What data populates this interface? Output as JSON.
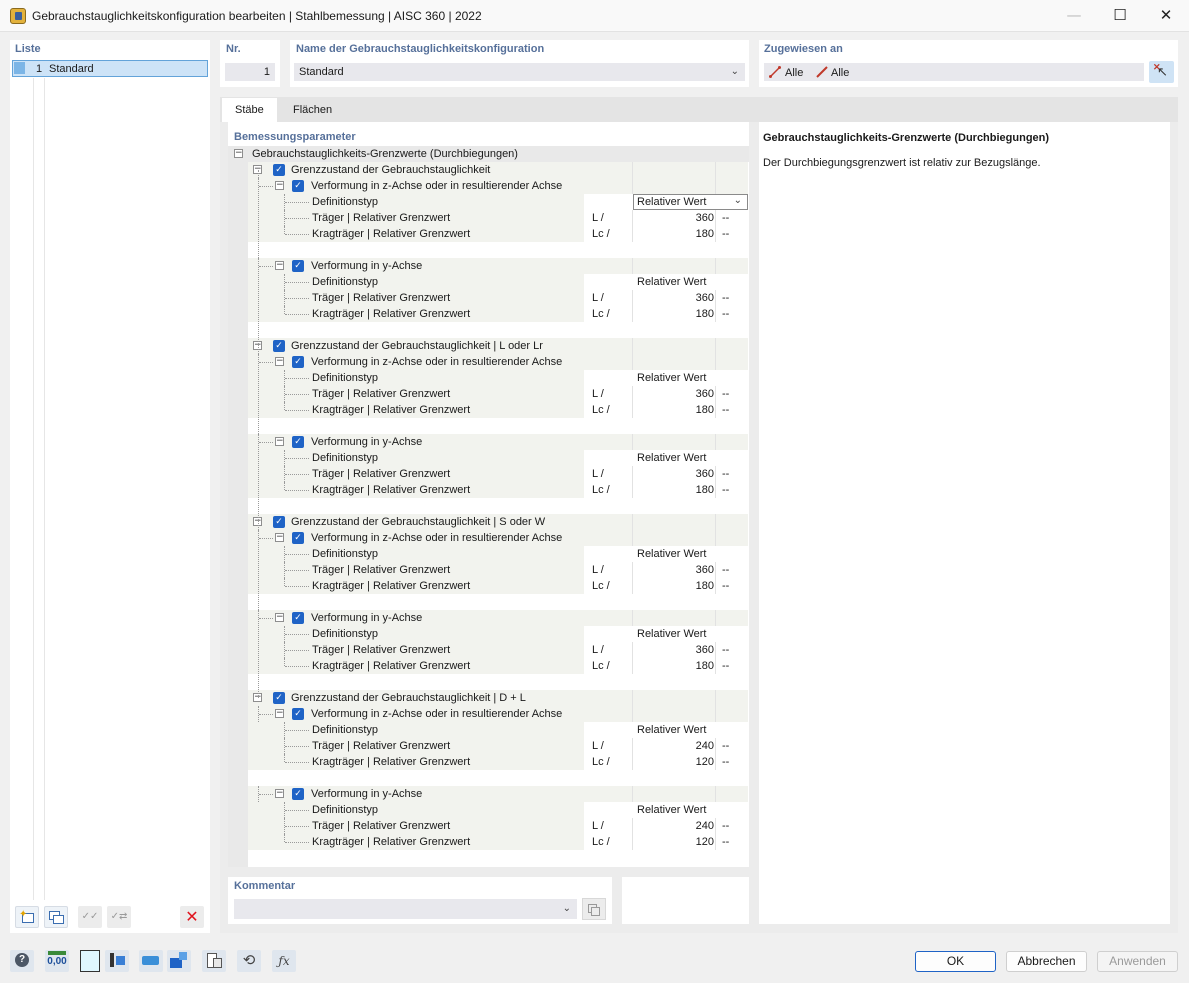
{
  "window": {
    "title": "Gebrauchstauglichkeitskonfiguration bearbeiten | Stahlbemessung | AISC 360 | 2022",
    "minimize": "—",
    "maximize": "☐",
    "close": "✕"
  },
  "list": {
    "label": "Liste",
    "items": [
      {
        "nr": "1",
        "name": "Standard"
      }
    ]
  },
  "nr": {
    "label": "Nr.",
    "value": "1"
  },
  "name": {
    "label": "Name der Gebrauchstauglichkeitskonfiguration",
    "value": "Standard"
  },
  "assigned": {
    "label": "Zugewiesen an",
    "members": "Alle",
    "surfaces": "Alle"
  },
  "tabs": [
    "Stäbe",
    "Flächen"
  ],
  "params": {
    "label": "Bemessungsparameter",
    "root": "Gebrauchstauglichkeits-Grenzwerte (Durchbiegungen)",
    "groups": [
      {
        "title": "Grenzzustand der Gebrauchstauglichkeit",
        "subs": [
          {
            "title": "Verformung in z-Achse oder in resultierender Achse",
            "def_label": "Definitionstyp",
            "def_value": "Relativer Wert",
            "beam_label": "Träger | Relativer Grenzwert",
            "beam_prefix": "L /",
            "beam_value": "360",
            "beam_unit": "--",
            "cant_label": "Kragträger | Relativer Grenzwert",
            "cant_prefix": "Lc /",
            "cant_value": "180",
            "cant_unit": "--"
          },
          {
            "title": "Verformung in y-Achse",
            "def_label": "Definitionstyp",
            "def_value": "Relativer Wert",
            "beam_label": "Träger | Relativer Grenzwert",
            "beam_prefix": "L /",
            "beam_value": "360",
            "beam_unit": "--",
            "cant_label": "Kragträger | Relativer Grenzwert",
            "cant_prefix": "Lc /",
            "cant_value": "180",
            "cant_unit": "--"
          }
        ]
      },
      {
        "title": "Grenzzustand der Gebrauchstauglichkeit | L oder Lr",
        "subs": [
          {
            "title": "Verformung in z-Achse oder in resultierender Achse",
            "def_label": "Definitionstyp",
            "def_value": "Relativer Wert",
            "beam_label": "Träger | Relativer Grenzwert",
            "beam_prefix": "L /",
            "beam_value": "360",
            "beam_unit": "--",
            "cant_label": "Kragträger | Relativer Grenzwert",
            "cant_prefix": "Lc /",
            "cant_value": "180",
            "cant_unit": "--"
          },
          {
            "title": "Verformung in y-Achse",
            "def_label": "Definitionstyp",
            "def_value": "Relativer Wert",
            "beam_label": "Träger | Relativer Grenzwert",
            "beam_prefix": "L /",
            "beam_value": "360",
            "beam_unit": "--",
            "cant_label": "Kragträger | Relativer Grenzwert",
            "cant_prefix": "Lc /",
            "cant_value": "180",
            "cant_unit": "--"
          }
        ]
      },
      {
        "title": "Grenzzustand der Gebrauchstauglichkeit | S oder W",
        "subs": [
          {
            "title": "Verformung in z-Achse oder in resultierender Achse",
            "def_label": "Definitionstyp",
            "def_value": "Relativer Wert",
            "beam_label": "Träger | Relativer Grenzwert",
            "beam_prefix": "L /",
            "beam_value": "360",
            "beam_unit": "--",
            "cant_label": "Kragträger | Relativer Grenzwert",
            "cant_prefix": "Lc /",
            "cant_value": "180",
            "cant_unit": "--"
          },
          {
            "title": "Verformung in y-Achse",
            "def_label": "Definitionstyp",
            "def_value": "Relativer Wert",
            "beam_label": "Träger | Relativer Grenzwert",
            "beam_prefix": "L /",
            "beam_value": "360",
            "beam_unit": "--",
            "cant_label": "Kragträger | Relativer Grenzwert",
            "cant_prefix": "Lc /",
            "cant_value": "180",
            "cant_unit": "--"
          }
        ]
      },
      {
        "title": "Grenzzustand der Gebrauchstauglichkeit | D + L",
        "subs": [
          {
            "title": "Verformung in z-Achse oder in resultierender Achse",
            "def_label": "Definitionstyp",
            "def_value": "Relativer Wert",
            "beam_label": "Träger | Relativer Grenzwert",
            "beam_prefix": "L /",
            "beam_value": "240",
            "beam_unit": "--",
            "cant_label": "Kragträger | Relativer Grenzwert",
            "cant_prefix": "Lc /",
            "cant_value": "120",
            "cant_unit": "--"
          },
          {
            "title": "Verformung in y-Achse",
            "def_label": "Definitionstyp",
            "def_value": "Relativer Wert",
            "beam_label": "Träger | Relativer Grenzwert",
            "beam_prefix": "L /",
            "beam_value": "240",
            "beam_unit": "--",
            "cant_label": "Kragträger | Relativer Grenzwert",
            "cant_prefix": "Lc /",
            "cant_value": "120",
            "cant_unit": "--"
          }
        ]
      }
    ]
  },
  "info": {
    "title": "Gebrauchstauglichkeits-Grenzwerte (Durchbiegungen)",
    "text": "Der Durchbiegungsgrenzwert ist relativ zur Bezugslänge."
  },
  "comment": {
    "label": "Kommentar",
    "value": ""
  },
  "toolbar": {
    "zero_label": "0,00"
  },
  "buttons": {
    "ok": "OK",
    "cancel": "Abbrechen",
    "apply": "Anwenden"
  },
  "colors": {
    "accent": "#1f63c6",
    "label": "#56709a",
    "selection": "#cde3f7",
    "delete": "#e0141e"
  }
}
